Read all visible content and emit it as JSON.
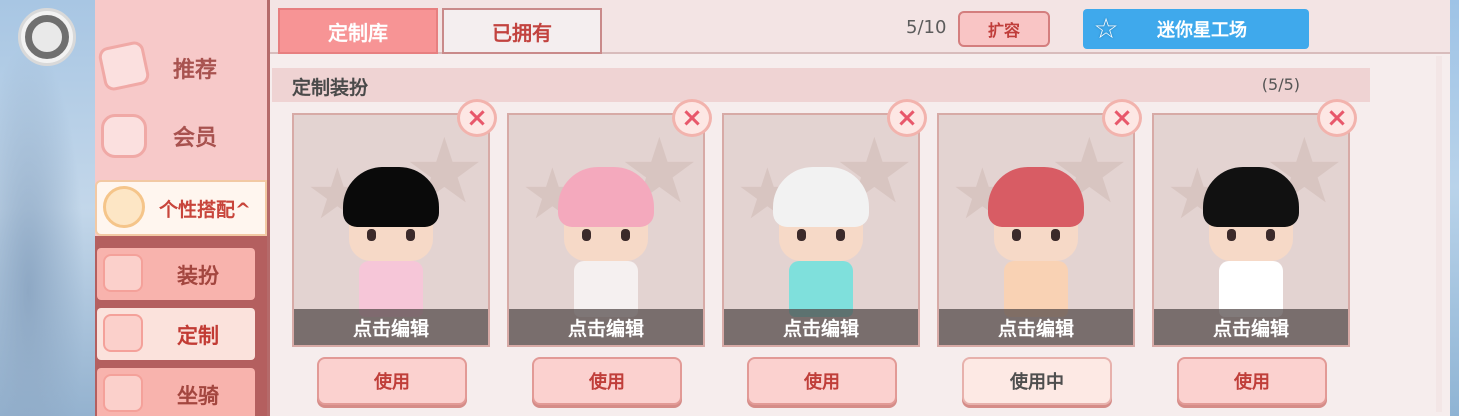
{
  "side_menu": {
    "items": [
      {
        "label": "推荐",
        "icon": "recommend-icon"
      },
      {
        "label": "会员",
        "icon": "member-icon"
      },
      {
        "label": "个性搭配",
        "icon": "style-icon",
        "expanded_marker": "^"
      }
    ],
    "sub_items": [
      {
        "label": "装扮",
        "icon": "costume-icon"
      },
      {
        "label": "定制",
        "icon": "custom-icon",
        "selected": true
      },
      {
        "label": "坐骑",
        "icon": "mount-icon"
      }
    ]
  },
  "tabs": [
    {
      "label": "定制库",
      "active": true
    },
    {
      "label": "已拥有",
      "active": false
    }
  ],
  "capacity": "5/10",
  "expand_label": "扩容",
  "factory_label": "迷你星工场",
  "section": {
    "title": "定制装扮",
    "count": "(5/5)"
  },
  "cards": [
    {
      "edit_label": "点击编辑",
      "use_label": "使用",
      "hair_color": "#0a0a0a",
      "outfit_color": "#f6c6d8"
    },
    {
      "edit_label": "点击编辑",
      "use_label": "使用",
      "hair_color": "#f4a9bd",
      "outfit_color": "#f5f0f0"
    },
    {
      "edit_label": "点击编辑",
      "use_label": "使用",
      "hair_color": "#f2f2f2",
      "outfit_color": "#7fe0dc"
    },
    {
      "edit_label": "点击编辑",
      "use_label": "使用中",
      "hair_color": "#d85c64",
      "outfit_color": "#f9d2b4"
    },
    {
      "edit_label": "点击编辑",
      "use_label": "使用",
      "hair_color": "#111111",
      "outfit_color": "#ffffff"
    }
  ],
  "colors": {
    "accent": "#f79495",
    "factory": "#3fa9ec",
    "panel": "#f6eded"
  }
}
